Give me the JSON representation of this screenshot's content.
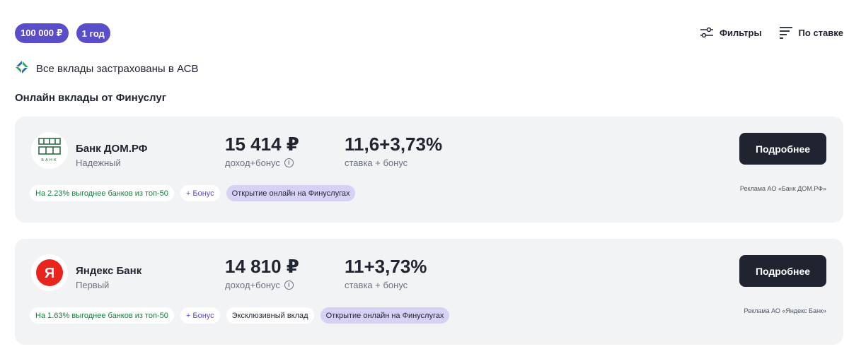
{
  "filters": {
    "amount_chip": "100 000 ₽",
    "term_chip": "1 год"
  },
  "toolbar": {
    "filters_label": "Фильтры",
    "sort_label": "По ставке"
  },
  "insurance_note": "Все вклады застрахованы в АСВ",
  "section_title": "Онлайн вклады от Финуслуг",
  "colors": {
    "accent": "#5a4dc9",
    "button": "#1f2430",
    "card_bg": "#f2f3f5",
    "tag_purple": "#d6d1f5",
    "green": "#15803d"
  },
  "offers": [
    {
      "bank_name": "Банк ДОМ.РФ",
      "bank_subtitle": "Надежный",
      "logo_text": "БАНК",
      "income": "15 414 ₽",
      "income_label": "доход+бонус",
      "rate": "11,6+3,73%",
      "rate_label": "ставка + бонус",
      "button_label": "Подробнее",
      "tags": {
        "benefit": "На 2.23% выгоднее банков из топ-50",
        "bonus": "+ Бонус",
        "online": "Открытие онлайн на Финуслугах"
      },
      "ad": "Реклама АО «Банк ДОМ.РФ»"
    },
    {
      "bank_name": "Яндекс Банк",
      "bank_subtitle": "Первый",
      "logo_text": "Я",
      "income": "14 810 ₽",
      "income_label": "доход+бонус",
      "rate": "11+3,73%",
      "rate_label": "ставка + бонус",
      "button_label": "Подробнее",
      "tags": {
        "benefit": "На 1.63% выгоднее банков из топ-50",
        "bonus": "+ Бонус",
        "exclusive": "Эксклюзивный вклад",
        "online": "Открытие онлайн на Финуслугах"
      },
      "ad": "Реклама АО «Яндекс Банк»"
    }
  ]
}
